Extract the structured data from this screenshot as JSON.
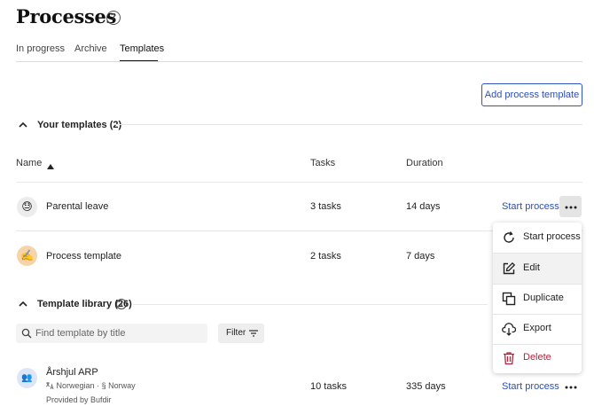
{
  "page": {
    "title": "Processes",
    "help_symbol": "?"
  },
  "tabs": [
    {
      "label": "In progress",
      "active": false
    },
    {
      "label": "Archive",
      "active": false
    },
    {
      "label": "Templates",
      "active": true
    }
  ],
  "toolbar": {
    "add_template_label": "Add process template"
  },
  "your_templates": {
    "heading": "Your templates (2)",
    "columns": {
      "name": "Name",
      "tasks": "Tasks",
      "duration": "Duration"
    },
    "sort_icon": "sort-ascending-icon",
    "rows": [
      {
        "avatar": "😓",
        "name": "Parental leave",
        "tasks": "3 tasks",
        "duration": "14 days",
        "action": "Start process"
      },
      {
        "avatar": "✍️",
        "name": "Process template",
        "tasks": "2 tasks",
        "duration": "7 days"
      }
    ]
  },
  "library": {
    "heading": "Template library (26)",
    "info_symbol": "i",
    "search_placeholder": "Find template by title",
    "filter_label": "Filter",
    "rows": [
      {
        "avatar": "👥",
        "name": "Årshjul ARP",
        "language_icon": "translate-icon",
        "language": "Norwegian",
        "separator": "·",
        "law_mark": "§",
        "law": "Norway",
        "provided_by_prefix": "Provided by",
        "provider": "Bufdir",
        "tasks": "10 tasks",
        "duration": "335 days",
        "action": "Start process"
      }
    ]
  },
  "context_menu": {
    "items": [
      {
        "label": "Start process",
        "icon": "refresh-icon"
      },
      {
        "label": "Edit",
        "icon": "edit-icon"
      },
      {
        "label": "Duplicate",
        "icon": "duplicate-icon"
      },
      {
        "label": "Export",
        "icon": "export-icon"
      },
      {
        "label": "Delete",
        "icon": "trash-icon"
      }
    ]
  },
  "colors": {
    "link": "#2b4fb8",
    "danger": "#b4233a",
    "border_accent": "#2f55c4"
  }
}
